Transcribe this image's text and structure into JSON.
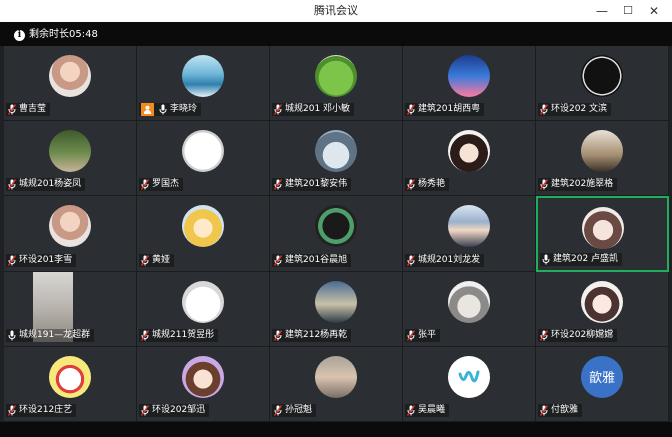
{
  "window": {
    "title": "腾讯会议",
    "min_label": "—",
    "max_label": "☐",
    "close_label": "✕"
  },
  "topbar": {
    "remaining_label": "剩余时长05:48"
  },
  "colors": {
    "active_border": "#1fae5b",
    "host_badge": "#f28a1e",
    "mic_muted": "#d9342b"
  },
  "participants": [
    {
      "name": "曹吉莹",
      "mic": "muted",
      "avatar": "photo-girl-icon"
    },
    {
      "name": "李晓玲",
      "mic": "on",
      "host": true,
      "avatar": "wave-icon"
    },
    {
      "name": "城规201 邓小敏",
      "mic": "muted",
      "avatar": "frog-icon"
    },
    {
      "name": "建筑201胡西粤",
      "mic": "muted",
      "avatar": "drink-icon"
    },
    {
      "name": "环设202 文滨",
      "mic": "muted",
      "avatar": "mask-icon"
    },
    {
      "name": "城规201杨姿凤",
      "mic": "muted",
      "avatar": "tree-girl-icon"
    },
    {
      "name": "罗国杰",
      "mic": "muted",
      "avatar": "sketch-face-icon"
    },
    {
      "name": "建筑201黎安伟",
      "mic": "muted",
      "avatar": "cartoon-bird-icon"
    },
    {
      "name": "杨秀艳",
      "mic": "muted",
      "avatar": "anime-girl-icon"
    },
    {
      "name": "建筑202施翠格",
      "mic": "muted",
      "avatar": "photo-couple-icon"
    },
    {
      "name": "环设201李雪",
      "mic": "muted",
      "avatar": "photo-girl-icon"
    },
    {
      "name": "黄娅",
      "mic": "muted",
      "avatar": "anime-blonde-icon"
    },
    {
      "name": "建筑201谷晨旭",
      "mic": "muted",
      "avatar": "mask-green-icon"
    },
    {
      "name": "城规201刘龙发",
      "mic": "muted",
      "avatar": "portrait-man-icon"
    },
    {
      "name": "建筑202  卢盛凯",
      "mic": "on",
      "avatar": "anime-boy-icon",
      "active": true
    },
    {
      "name": "城规191—龙超群",
      "mic": "on",
      "avatar": "video-feed-icon",
      "square": true
    },
    {
      "name": "城规211贺昱彤",
      "mic": "muted",
      "avatar": "sketch-bear-icon"
    },
    {
      "name": "建筑212杨再乾",
      "mic": "muted",
      "avatar": "sunset-couple-icon"
    },
    {
      "name": "张平",
      "mic": "muted",
      "avatar": "hand-icon"
    },
    {
      "name": "环设202柳嫦嫦",
      "mic": "muted",
      "avatar": "anime-girl-white-icon"
    },
    {
      "name": "环设212庄艺",
      "mic": "muted",
      "avatar": "hello-kitty-icon"
    },
    {
      "name": "环设202邹迅",
      "mic": "muted",
      "avatar": "cartoon-girl-icon"
    },
    {
      "name": "孙冠魁",
      "mic": "muted",
      "avatar": "portrait-boy-icon"
    },
    {
      "name": "吴晨曦",
      "mic": "muted",
      "avatar": "w-logo-icon"
    },
    {
      "name": "付歆雅",
      "mic": "muted",
      "avatar": "text-avatar",
      "avatar_text": "歆雅"
    }
  ]
}
